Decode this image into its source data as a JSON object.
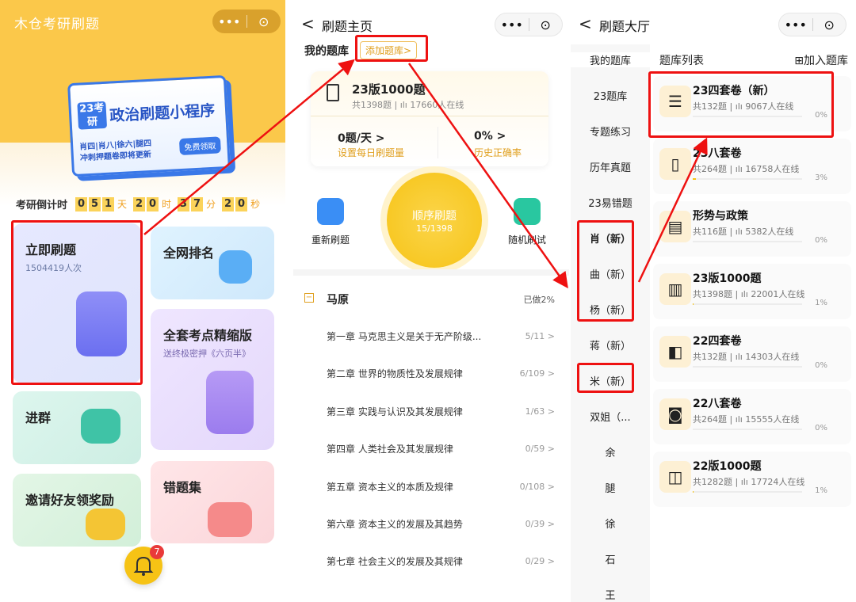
{
  "colors": {
    "accent": "#f6c315",
    "brand_blue": "#3a78e8",
    "highlight": "#e11111"
  },
  "panel_home": {
    "app_title": "木仓考研刷题",
    "capsule": {
      "more": "•••",
      "close": "⊙"
    },
    "banner": {
      "year": "23考研",
      "title": "政治刷题小程序",
      "subtitle_1": "肖四|肖八|徐六|腿四",
      "subtitle_2": "冲刺押题卷即将更新",
      "button": "免费领取"
    },
    "countdown": {
      "label": "考研倒计时",
      "days": [
        "0",
        "5",
        "1"
      ],
      "day_unit": "天",
      "hours": [
        "2",
        "0"
      ],
      "hour_unit": "时",
      "minutes": [
        "3",
        "7"
      ],
      "minute_unit": "分",
      "seconds": [
        "2",
        "0"
      ],
      "second_unit": "秒"
    },
    "cards": {
      "start": {
        "title": "立即刷题",
        "sub": "1504419人次"
      },
      "ranking": {
        "title": "全网排名"
      },
      "notes": {
        "title": "全套考点精缩版",
        "sub": "送终极密押《六页半》"
      },
      "group": {
        "title": "进群"
      },
      "invite": {
        "title": "邀请好友领奖励"
      },
      "wrong": {
        "title": "错题集"
      }
    },
    "bell_badge": "7"
  },
  "panel_practice": {
    "back": "<",
    "title": "刷题主页",
    "my_bank": "我的题库",
    "add_bank": "添加题库>",
    "current_bank": {
      "name": "23版1000题",
      "meta": "共1398题 | ılı 17660人在线"
    },
    "stats": {
      "daily": "0题/天",
      "daily_label": "设置每日刷题量",
      "accuracy": "0%",
      "accuracy_label": "历史正确率"
    },
    "actions": {
      "redo": "重新刷题",
      "sequential": "顺序刷题",
      "sequential_progress": "15/1398",
      "random": "随机刷试"
    },
    "section": {
      "name": "马原",
      "done": "已做2%"
    },
    "chapters": [
      {
        "title": "第一章 马克思主义是关于无产阶级...",
        "progress": "5/11 >"
      },
      {
        "title": "第二章 世界的物质性及发展规律",
        "progress": "6/109 >"
      },
      {
        "title": "第三章 实践与认识及其发展规律",
        "progress": "1/63 >"
      },
      {
        "title": "第四章 人类社会及其发展规律",
        "progress": "0/59 >"
      },
      {
        "title": "第五章 资本主义的本质及规律",
        "progress": "0/108 >"
      },
      {
        "title": "第六章 资本主义的发展及其趋势",
        "progress": "0/39 >"
      },
      {
        "title": "第七章 社会主义的发展及其规律",
        "progress": "0/29 >"
      }
    ]
  },
  "panel_hall": {
    "back": "<",
    "title": "刷题大厅",
    "list_title": "题库列表",
    "join": "⊞加入题库",
    "sidebar": [
      "我的题库",
      "23题库",
      "专题练习",
      "历年真题",
      "23易错题",
      "肖（新）",
      "曲（新）",
      "杨（新）",
      "蒋（新）",
      "米（新）",
      "双姐（...",
      "余",
      "腿",
      "徐",
      "石",
      "王"
    ],
    "banks": [
      {
        "title": "23四套卷（新）",
        "meta": "共132题 | ılı 9067人在线",
        "pct": "0%",
        "progress": 0
      },
      {
        "title": "23八套卷",
        "meta": "共264题 | ılı 16758人在线",
        "pct": "3%",
        "progress": 0.03
      },
      {
        "title": "形势与政策",
        "meta": "共116题 | ılı 5382人在线",
        "pct": "0%",
        "progress": 0
      },
      {
        "title": "23版1000题",
        "meta": "共1398题 | ılı 22001人在线",
        "pct": "1%",
        "progress": 0.01
      },
      {
        "title": "22四套卷",
        "meta": "共132题 | ılı 14303人在线",
        "pct": "0%",
        "progress": 0
      },
      {
        "title": "22八套卷",
        "meta": "共264题 | ılı 15555人在线",
        "pct": "0%",
        "progress": 0
      },
      {
        "title": "22版1000题",
        "meta": "共1282题 | ılı 17724人在线",
        "pct": "1%",
        "progress": 0.01
      }
    ]
  }
}
